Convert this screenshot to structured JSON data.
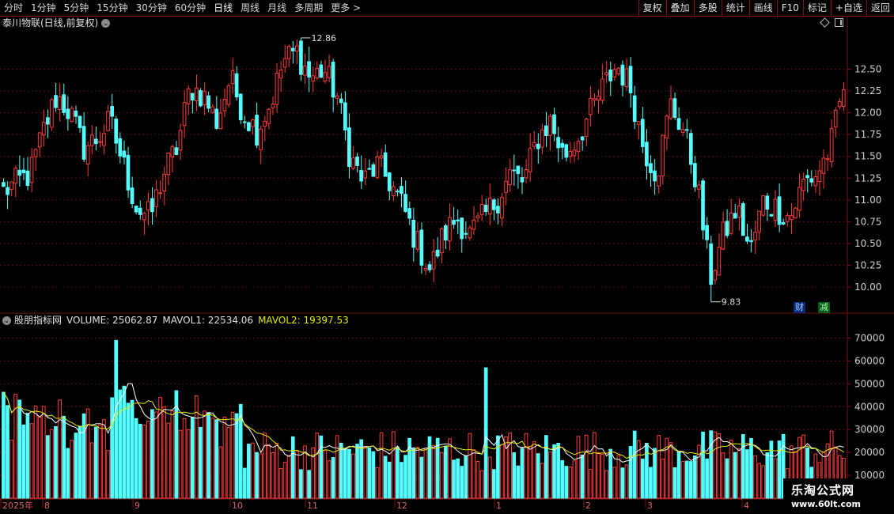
{
  "toolbar": {
    "periods": [
      "分时",
      "1分钟",
      "5分钟",
      "15分钟",
      "30分钟",
      "60分钟",
      "日线",
      "周线",
      "月线",
      "多周期",
      "更多 >"
    ],
    "active_period": "日线",
    "buttons": [
      "复权",
      "叠加",
      "多股",
      "统计",
      "画线",
      "F10",
      "标记",
      "+自选",
      "返回"
    ]
  },
  "price_panel": {
    "title": "泰川物联(日线,前复权)",
    "y_ticks": [
      "12.50",
      "12.25",
      "12.00",
      "11.75",
      "11.50",
      "11.25",
      "11.00",
      "10.75",
      "10.50",
      "10.25",
      "10.00"
    ],
    "high_label": "12.86",
    "low_label": "9.83",
    "badges": [
      "财",
      "减"
    ]
  },
  "volume_panel": {
    "indicator_name": "股朋指标网",
    "volume_text": "VOLUME: 25062.87",
    "mavol1_text": "MAVOL1: 22534.06",
    "mavol2_text": "MAVOL2: 19397.53",
    "y_ticks": [
      "70000",
      "60000",
      "50000",
      "40000",
      "30000",
      "20000",
      "10000"
    ]
  },
  "x_axis": {
    "labels": [
      "2025年",
      "8",
      "9",
      "10",
      "11",
      "12",
      "1",
      "2",
      "3",
      "4"
    ]
  },
  "watermark": {
    "line1": "乐淘公式网",
    "line2": "www.60lt.com"
  },
  "colors": {
    "up": "#ff3a3a",
    "down": "#54ffff",
    "mavol1": "#ffffff",
    "mavol2": "#e8e800",
    "frame": "#7a1010"
  },
  "chart_data": {
    "type": "candlestick",
    "price_ylim": [
      9.7,
      12.95
    ],
    "volume_ylim": [
      0,
      75000
    ],
    "series_hint": "daily candles from mid-2025 to 2026-04",
    "anchor_closes": [
      11.1,
      11.2,
      11.3,
      11.8,
      12.2,
      12.0,
      11.6,
      11.7,
      11.9,
      11.4,
      10.9,
      10.8,
      11.3,
      11.6,
      12.3,
      12.2,
      11.9,
      12.4,
      12.0,
      11.8,
      12.1,
      12.6,
      12.7,
      12.4,
      12.5,
      12.2,
      11.5,
      11.2,
      11.4,
      11.2,
      10.9,
      10.5,
      10.2,
      10.6,
      10.8,
      10.6,
      10.8,
      11.0,
      11.3,
      11.2,
      11.7,
      11.9,
      11.5,
      11.7,
      12.0,
      12.3,
      12.55,
      12.3,
      11.6,
      11.3,
      12.1,
      11.8,
      11.2,
      10.1,
      10.6,
      10.9,
      10.4,
      11.0,
      10.9,
      10.8,
      11.2,
      11.3,
      11.6,
      12.3
    ]
  }
}
